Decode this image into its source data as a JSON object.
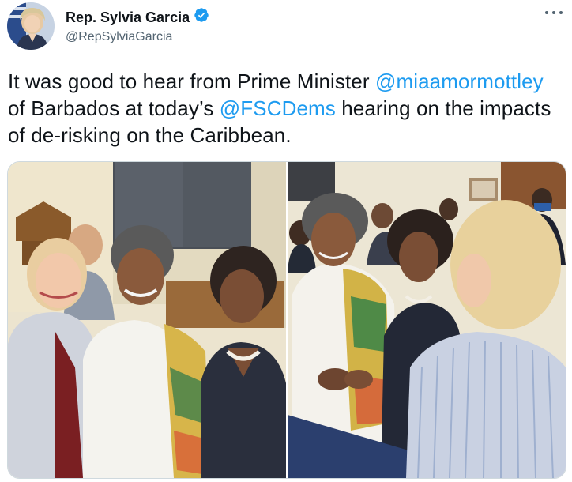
{
  "author": {
    "display_name": "Rep. Sylvia Garcia",
    "handle": "@RepSylviaGarcia",
    "verified": true,
    "verified_color": "#1d9bf0"
  },
  "tweet": {
    "segments": [
      {
        "text": "It was good to hear from Prime Minister ",
        "type": "text"
      },
      {
        "text": "@miaamormottley",
        "type": "mention"
      },
      {
        "text": " of Barbados at today’s ",
        "type": "text"
      },
      {
        "text": "@FSCDems",
        "type": "mention"
      },
      {
        "text": " hearing on the impacts of de-risking on the Caribbean.",
        "type": "text"
      }
    ]
  },
  "media": {
    "count": 2,
    "photos": [
      {
        "subject": "three women posing together in a hearing room"
      },
      {
        "subject": "women greeting and shaking hands in a hearing room"
      }
    ]
  },
  "colors": {
    "text": "#0f1419",
    "secondary": "#536471",
    "link": "#1d9bf0",
    "border": "#cfd9de"
  },
  "icons": {
    "verified": "verified-badge-icon",
    "more": "more-options-icon"
  }
}
